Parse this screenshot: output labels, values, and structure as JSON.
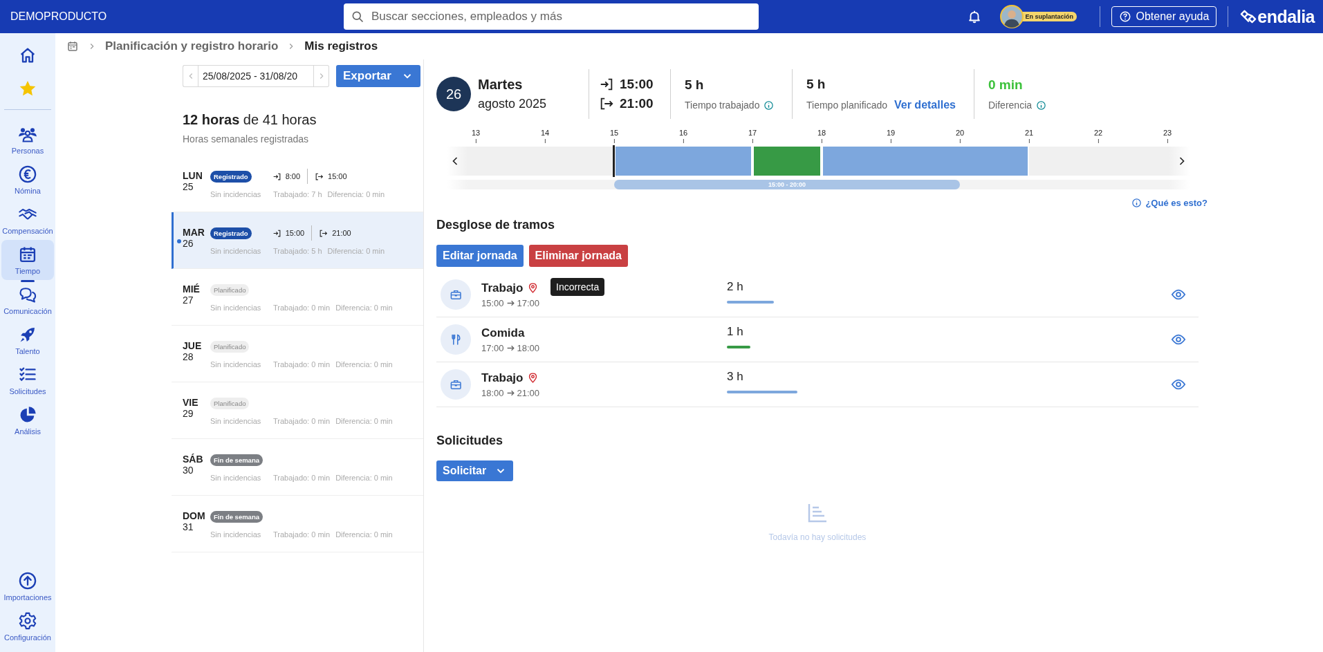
{
  "app": {
    "brand": "DEMOPRODUCTO",
    "search_placeholder": "Buscar secciones, empleados y más",
    "impersonation_badge": "En suplantación",
    "help_button": "Obtener ayuda",
    "logo": "endalia"
  },
  "sidebar": {
    "shortcuts": [
      {
        "kind": "home"
      },
      {
        "kind": "star"
      }
    ],
    "items": [
      {
        "kind": "people",
        "label": "Personas",
        "selected": false
      },
      {
        "kind": "euro",
        "label": "Nómina",
        "selected": false
      },
      {
        "kind": "handshake",
        "label": "Compensación",
        "selected": false
      },
      {
        "kind": "calendar",
        "label": "Tiempo",
        "selected": true
      },
      {
        "kind": "chat",
        "label": "Comunicación",
        "selected": false
      },
      {
        "kind": "rocket",
        "label": "Talento",
        "selected": false
      },
      {
        "kind": "checklist",
        "label": "Solicitudes",
        "selected": false
      },
      {
        "kind": "pie",
        "label": "Análisis",
        "selected": false
      }
    ],
    "bottom_items": [
      {
        "kind": "upload",
        "label": "Importaciones",
        "selected": false
      },
      {
        "kind": "gear",
        "label": "Configuración",
        "selected": false
      }
    ]
  },
  "breadcrumb": [
    "Planificación y registro horario",
    "Mis registros"
  ],
  "week": {
    "range": "25/08/2025 - 31/08/20",
    "export_button": "Exportar",
    "total": "**12 horas** de 41 horas",
    "subtitle": "Horas semanales registradas"
  },
  "days": [
    {
      "weekday": "LUN",
      "date": "25",
      "status": "Registrado",
      "kind": "registered",
      "selected": false,
      "clock_in": "8:00",
      "clock_out": "15:00",
      "incidents": "Sin incidencias",
      "worked": "Trabajado: 7 h",
      "difference": "Diferencia: 0 min"
    },
    {
      "weekday": "MAR",
      "date": "26",
      "status": "Registrado",
      "kind": "registered",
      "selected": true,
      "clock_in": "15:00",
      "clock_out": "21:00",
      "incidents": "Sin incidencias",
      "worked": "Trabajado: 5 h",
      "difference": "Diferencia: 0 min"
    },
    {
      "weekday": "MIÉ",
      "date": "27",
      "status": "Planificado",
      "kind": "planned",
      "selected": false,
      "incidents": "Sin incidencias",
      "worked": "Trabajado: 0 min",
      "difference": "Diferencia: 0 min"
    },
    {
      "weekday": "JUE",
      "date": "28",
      "status": "Planificado",
      "kind": "planned",
      "selected": false,
      "incidents": "Sin incidencias",
      "worked": "Trabajado: 0 min",
      "difference": "Diferencia: 0 min"
    },
    {
      "weekday": "VIE",
      "date": "29",
      "status": "Planificado",
      "kind": "planned",
      "selected": false,
      "incidents": "Sin incidencias",
      "worked": "Trabajado: 0 min",
      "difference": "Diferencia: 0 min"
    },
    {
      "weekday": "SÁB",
      "date": "30",
      "status": "Fin de semana",
      "kind": "weekend",
      "selected": false,
      "incidents": "Sin incidencias",
      "worked": "Trabajado: 0 min",
      "difference": "Diferencia: 0 min"
    },
    {
      "weekday": "DOM",
      "date": "31",
      "status": "Fin de semana",
      "kind": "weekend",
      "selected": false,
      "incidents": "Sin incidencias",
      "worked": "Trabajado: 0 min",
      "difference": "Diferencia: 0 min"
    }
  ],
  "day_detail": {
    "day": "26",
    "weekday": "Martes",
    "month": "agosto 2025",
    "clock_in": "15:00",
    "clock_out": "21:00",
    "worked": "5 h",
    "worked_label": "Tiempo trabajado",
    "planned": "5 h",
    "planned_label": "Tiempo planificado",
    "details_link": "Ver detalles",
    "difference": "0 min",
    "difference_label": "Diferencia"
  },
  "timeline": {
    "hours": [
      "13",
      "14",
      "15",
      "16",
      "17",
      "18",
      "19",
      "20",
      "21",
      "22",
      "23"
    ],
    "range_label": "15:00 - 20:00",
    "help_link": "¿Qué es esto?"
  },
  "breakdown": {
    "title": "Desglose de tramos",
    "edit_button": "Editar jornada",
    "delete_button": "Eliminar jornada",
    "segments": [
      {
        "kind": "work",
        "name": "Trabajo",
        "start": "15:00",
        "end": "17:00",
        "duration": "2 h",
        "location_flag": true,
        "tooltip": "Incorrecta"
      },
      {
        "kind": "meal",
        "name": "Comida",
        "start": "17:00",
        "end": "18:00",
        "duration": "1 h",
        "location_flag": false
      },
      {
        "kind": "work",
        "name": "Trabajo",
        "start": "18:00",
        "end": "21:00",
        "duration": "3 h",
        "location_flag": true
      }
    ]
  },
  "requests": {
    "title": "Solicitudes",
    "button": "Solicitar",
    "empty": "Todavía no hay solicitudes"
  }
}
